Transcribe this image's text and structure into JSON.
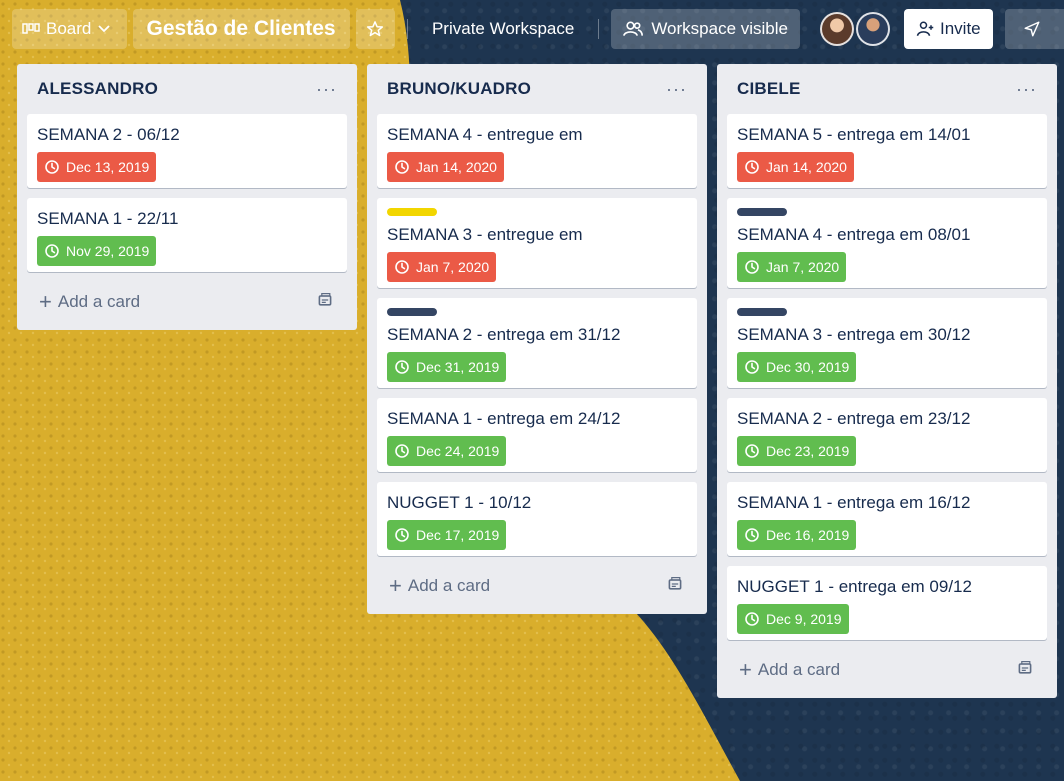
{
  "header": {
    "view_label": "Board",
    "board_title": "Gestão de Clientes",
    "workspace": "Private Workspace",
    "visibility": "Workspace visible",
    "invite": "Invite"
  },
  "colors": {
    "red": "#eb5a46",
    "green": "#61bd4f",
    "yellow": "#f2d600",
    "navy": "#344563"
  },
  "add_card_label": "Add a card",
  "lists": [
    {
      "title": "ALESSANDRO",
      "cards": [
        {
          "title": "SEMANA 2 - 06/12",
          "due": "Dec 13, 2019",
          "status": "red"
        },
        {
          "title": "SEMANA 1 - 22/11",
          "due": "Nov 29, 2019",
          "status": "green"
        }
      ]
    },
    {
      "title": "BRUNO/KUADRO",
      "cards": [
        {
          "title": "SEMANA 4 - entregue em",
          "due": "Jan 14, 2020",
          "status": "red"
        },
        {
          "title": "SEMANA 3 - entregue em",
          "due": "Jan 7, 2020",
          "status": "red",
          "label": "yellow"
        },
        {
          "title": "SEMANA 2 - entrega em 31/12",
          "due": "Dec 31, 2019",
          "status": "green",
          "label": "navy"
        },
        {
          "title": "SEMANA 1 - entrega em 24/12",
          "due": "Dec 24, 2019",
          "status": "green"
        },
        {
          "title": "NUGGET 1 - 10/12",
          "due": "Dec 17, 2019",
          "status": "green"
        }
      ]
    },
    {
      "title": "CIBELE",
      "cards": [
        {
          "title": "SEMANA 5 - entrega em 14/01",
          "due": "Jan 14, 2020",
          "status": "red"
        },
        {
          "title": "SEMANA 4 - entrega em 08/01",
          "due": "Jan 7, 2020",
          "status": "green",
          "label": "navy"
        },
        {
          "title": "SEMANA 3 - entrega em 30/12",
          "due": "Dec 30, 2019",
          "status": "green",
          "label": "navy"
        },
        {
          "title": "SEMANA 2 - entrega em 23/12",
          "due": "Dec 23, 2019",
          "status": "green"
        },
        {
          "title": "SEMANA 1 - entrega em 16/12",
          "due": "Dec 16, 2019",
          "status": "green"
        },
        {
          "title": "NUGGET 1 - entrega em 09/12",
          "due": "Dec 9, 2019",
          "status": "green"
        }
      ]
    }
  ]
}
